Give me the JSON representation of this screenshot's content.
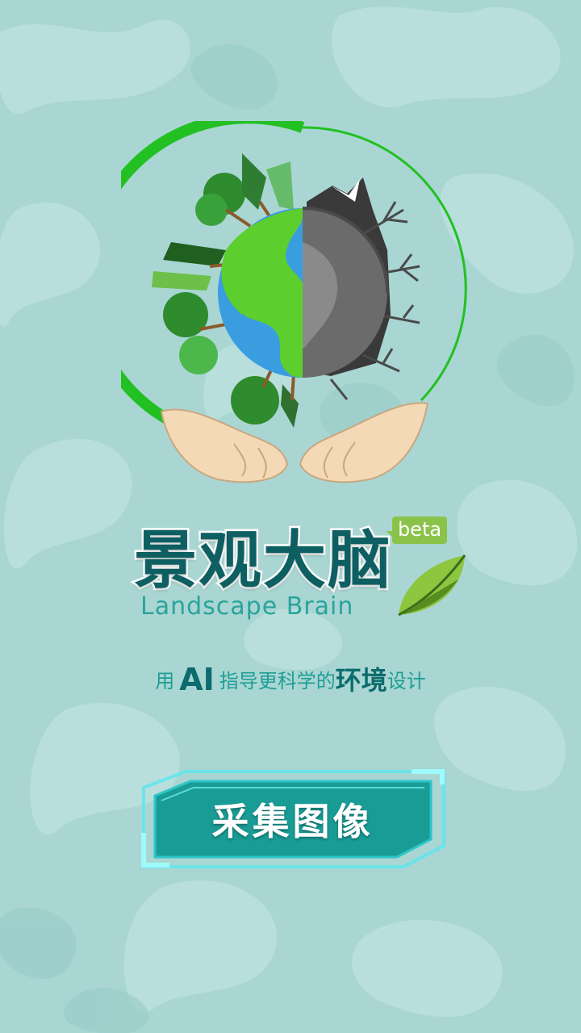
{
  "app": {
    "title_cn": "景观大脑",
    "title_en": "Landscape Brain",
    "badge": "beta"
  },
  "slogan": {
    "prefix": "用",
    "ai": "AI",
    "middle": "指导更科学的",
    "emphasis": "环境",
    "suffix": "设计"
  },
  "capture_button": {
    "label": "采集图像"
  },
  "colors": {
    "background": "#a9d6d3",
    "title_text": "#0d5f62",
    "subtitle_text": "#2aa39c",
    "badge_bg": "#8bc34a",
    "button_fill": "#1a9c96",
    "button_glow": "#3fe0e8",
    "ring_green": "#2cc02c"
  },
  "icons": [
    "earth-half-green-half-dead-icon",
    "hands-icon",
    "leaf-icon"
  ]
}
